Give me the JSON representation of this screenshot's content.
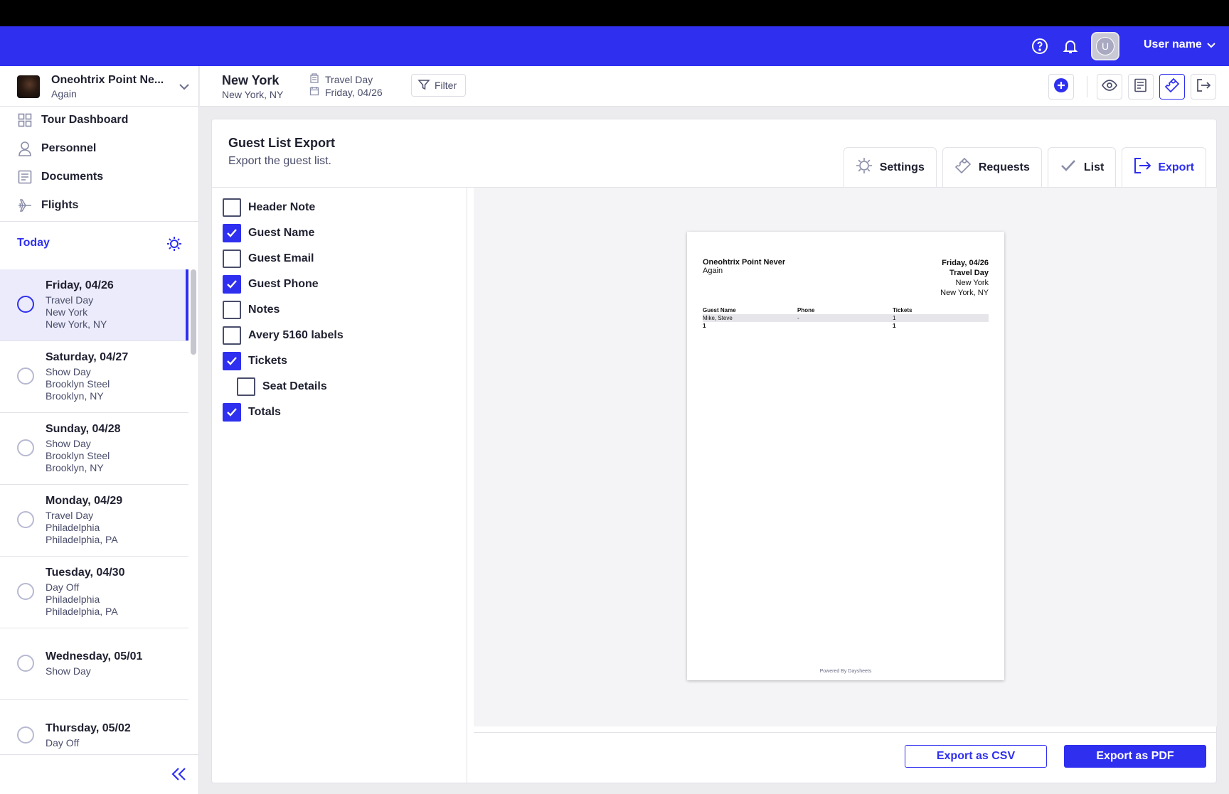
{
  "header": {
    "user_name": "User name",
    "avatar_initial": "U"
  },
  "tour": {
    "name": "Oneohtrix Point Ne...",
    "subtitle": "Again"
  },
  "nav": [
    {
      "label": "Tour Dashboard",
      "icon": "grid-icon"
    },
    {
      "label": "Personnel",
      "icon": "person-icon"
    },
    {
      "label": "Documents",
      "icon": "document-icon"
    },
    {
      "label": "Flights",
      "icon": "plane-icon"
    }
  ],
  "today": {
    "label": "Today"
  },
  "days": [
    {
      "date": "Friday, 04/26",
      "type": "Travel Day",
      "place": "New York",
      "location": "New York, NY",
      "active": true
    },
    {
      "date": "Saturday, 04/27",
      "type": "Show Day",
      "place": "Brooklyn Steel",
      "location": "Brooklyn, NY"
    },
    {
      "date": "Sunday, 04/28",
      "type": "Show Day",
      "place": "Brooklyn Steel",
      "location": "Brooklyn, NY"
    },
    {
      "date": "Monday, 04/29",
      "type": "Travel Day",
      "place": "Philadelphia",
      "location": "Philadelphia, PA"
    },
    {
      "date": "Tuesday, 04/30",
      "type": "Day Off",
      "place": "Philadelphia",
      "location": "Philadelphia, PA"
    },
    {
      "date": "Wednesday, 05/01",
      "type": "Show Day"
    },
    {
      "date": "Thursday, 05/02",
      "type": "Day Off"
    }
  ],
  "subheader": {
    "city": "New York",
    "city_sub": "New York, NY",
    "day_type": "Travel Day",
    "day_date": "Friday, 04/26",
    "filter_label": "Filter"
  },
  "card": {
    "title": "Guest List Export",
    "subtitle": "Export the guest list.",
    "tabs": [
      {
        "label": "Settings",
        "icon": "gear-icon"
      },
      {
        "label": "Requests",
        "icon": "ticket-icon"
      },
      {
        "label": "List",
        "icon": "check-icon"
      },
      {
        "label": "Export",
        "icon": "export-icon",
        "active": true
      }
    ]
  },
  "options": [
    {
      "label": "Header Note",
      "checked": false
    },
    {
      "label": "Guest Name",
      "checked": true
    },
    {
      "label": "Guest Email",
      "checked": false
    },
    {
      "label": "Guest Phone",
      "checked": true
    },
    {
      "label": "Notes",
      "checked": false
    },
    {
      "label": "Avery 5160 labels",
      "checked": false
    },
    {
      "label": "Tickets",
      "checked": true
    },
    {
      "label": "Seat Details",
      "checked": false,
      "indent": true
    },
    {
      "label": "Totals",
      "checked": true
    }
  ],
  "preview": {
    "artist": "Oneohtrix Point Never",
    "tour": "Again",
    "date": "Friday, 04/26",
    "day_type": "Travel Day",
    "city": "New York",
    "location": "New York, NY",
    "columns": [
      "Guest Name",
      "Phone",
      "Tickets"
    ],
    "rows": [
      [
        "Mike, Steve",
        "-",
        "1"
      ]
    ],
    "totals": [
      "1",
      "",
      "1"
    ],
    "footer": "Powered By Daysheets"
  },
  "actions": {
    "csv": "Export as CSV",
    "pdf": "Export as PDF"
  },
  "colors": {
    "brand": "#2f2ff0",
    "active_row": "#ebebfb"
  }
}
